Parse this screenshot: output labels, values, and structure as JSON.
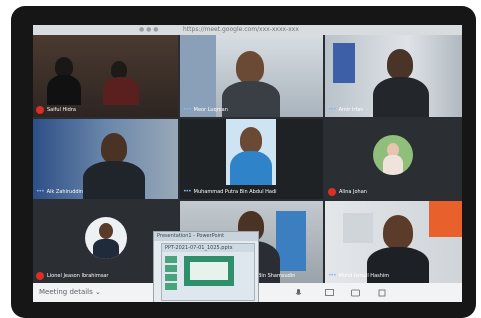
{
  "url": "https://meet.google.com/xxx-xxxx-xxx",
  "participants": [
    {
      "name": "Saiful Hidra",
      "muted": true
    },
    {
      "name": "Meor Luqman",
      "muted": false
    },
    {
      "name": "Amir Irfan",
      "muted": false
    },
    {
      "name": "Aik Zahiruddin",
      "muted": false
    },
    {
      "name": "Muhammad Putra Bin Abdul Hadi",
      "muted": false
    },
    {
      "name": "Alina Johan",
      "muted": true
    },
    {
      "name": "Lionel Jeason Ibrahimsar",
      "muted": true
    },
    {
      "name": "Bin Shamsudin",
      "muted": false
    },
    {
      "name": "Mohd Ismail Hashim",
      "muted": false
    }
  ],
  "meeting_details_label": "Meeting details",
  "meeting_details_chevron": "⌄",
  "popup_title": "Presentation1 - PowerPoint",
  "popup_subtitle": "PPT-2021-07-01_1025.pptx",
  "icons": [
    "microphone-icon",
    "present-icon",
    "more-options-icon",
    "captions-icon",
    "mic-muted-icon",
    "more-dots-icon"
  ],
  "colors": {
    "muted": "#d93025",
    "more": "#8ab4f8",
    "bar": "#f1f3f4",
    "bezel": "#161616"
  }
}
